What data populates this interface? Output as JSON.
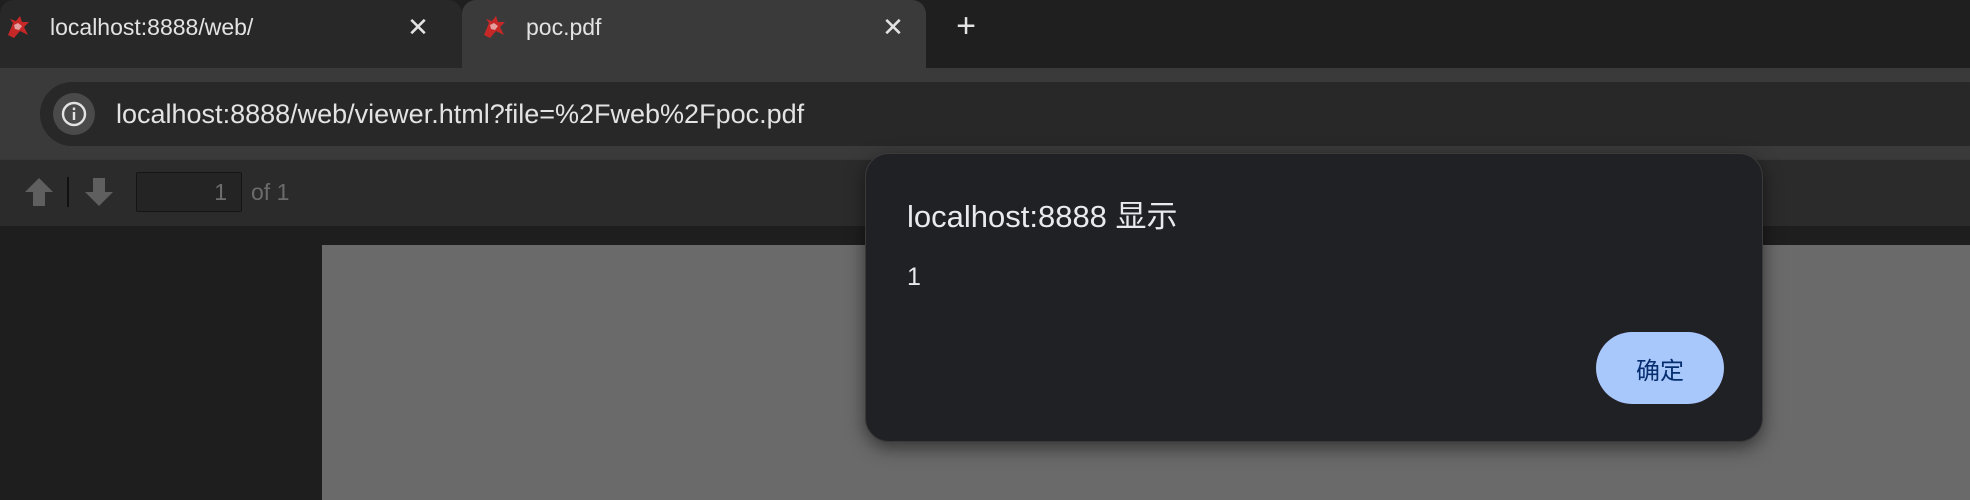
{
  "tabs": [
    {
      "title": "localhost:8888/web/",
      "active": false,
      "icon": "pdfjs-logo-icon"
    },
    {
      "title": "poc.pdf",
      "active": true,
      "icon": "pdfjs-logo-icon"
    }
  ],
  "new_tab_symbol": "+",
  "close_symbol": "✕",
  "address_bar": {
    "url": "localhost:8888/web/viewer.html?file=%2Fweb%2Fpoc.pdf",
    "left_edge_glyph": "⋮"
  },
  "pdf_toolbar": {
    "page_number": "1",
    "page_count_label": "of 1"
  },
  "alert_dialog": {
    "title": "localhost:8888 显示",
    "message": "1",
    "ok_label": "确定"
  },
  "colors": {
    "dialog_button_bg": "#a8c7fa",
    "dialog_button_text": "#062e6f",
    "favicon_red": "#c62828"
  }
}
